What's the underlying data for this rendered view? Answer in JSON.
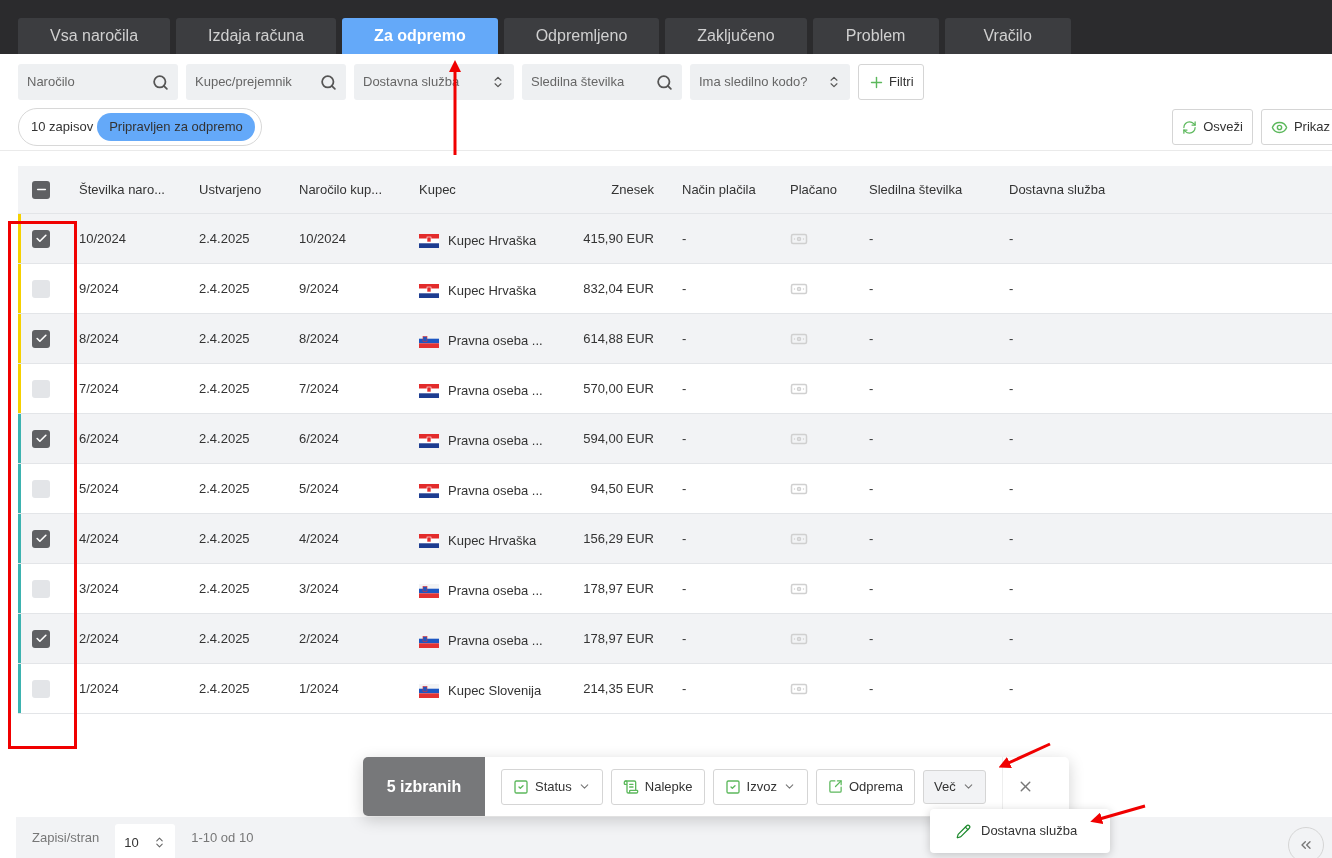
{
  "tabs": [
    {
      "label": "Vsa naročila",
      "selected": false
    },
    {
      "label": "Izdaja računa",
      "selected": false
    },
    {
      "label": "Za odpremo",
      "selected": true
    },
    {
      "label": "Odpremljeno",
      "selected": false
    },
    {
      "label": "Zaključeno",
      "selected": false
    },
    {
      "label": "Problem",
      "selected": false
    },
    {
      "label": "Vračilo",
      "selected": false
    }
  ],
  "filters": [
    {
      "kind": "search",
      "placeholder": "Naročilo"
    },
    {
      "kind": "search",
      "placeholder": "Kupec/prejemnik"
    },
    {
      "kind": "select",
      "placeholder": "Dostavna služba"
    },
    {
      "kind": "search",
      "placeholder": "Sledilna številka"
    },
    {
      "kind": "select",
      "placeholder": "Ima sledilno kodo?"
    }
  ],
  "filters_button": "Filtri",
  "summary": {
    "count": "10 zapisov",
    "badge": "Pripravljen za odpremo"
  },
  "toolbar_buttons": [
    {
      "kind": "refresh",
      "label": "Osveži"
    },
    {
      "kind": "view",
      "label": "Prikaz"
    }
  ],
  "table": {
    "select_all_indeterminate": true,
    "columns": [
      "Številka naro...",
      "Ustvarjeno",
      "Naročilo kup...",
      "Kupec",
      "Znesek",
      "Način plačila",
      "Plačano",
      "Sledilna številka",
      "Dostavna služba"
    ],
    "rows": [
      {
        "checked": true,
        "color": "#f5d000",
        "order": "10/2024",
        "created": "2.4.2025",
        "customer_order": "10/2024",
        "kind": "hr",
        "customer": "Kupec Hrvaška",
        "amount": "415,90 EUR",
        "payment": "-",
        "tracking": "-",
        "delivery": "-"
      },
      {
        "checked": false,
        "color": "#f5d000",
        "order": "9/2024",
        "created": "2.4.2025",
        "customer_order": "9/2024",
        "kind": "hr",
        "customer": "Kupec Hrvaška",
        "amount": "832,04 EUR",
        "payment": "-",
        "tracking": "-",
        "delivery": "-"
      },
      {
        "checked": true,
        "color": "#f5d000",
        "order": "8/2024",
        "created": "2.4.2025",
        "customer_order": "8/2024",
        "kind": "si",
        "customer": "Pravna oseba ...",
        "amount": "614,88 EUR",
        "payment": "-",
        "tracking": "-",
        "delivery": "-"
      },
      {
        "checked": false,
        "color": "#f5d000",
        "order": "7/2024",
        "created": "2.4.2025",
        "customer_order": "7/2024",
        "kind": "hr",
        "customer": "Pravna oseba ...",
        "amount": "570,00 EUR",
        "payment": "-",
        "tracking": "-",
        "delivery": "-"
      },
      {
        "checked": true,
        "color": "#3bb3b0",
        "order": "6/2024",
        "created": "2.4.2025",
        "customer_order": "6/2024",
        "kind": "hr",
        "customer": "Pravna oseba ...",
        "amount": "594,00 EUR",
        "payment": "-",
        "tracking": "-",
        "delivery": "-"
      },
      {
        "checked": false,
        "color": "#3bb3b0",
        "order": "5/2024",
        "created": "2.4.2025",
        "customer_order": "5/2024",
        "kind": "hr",
        "customer": "Pravna oseba ...",
        "amount": "94,50 EUR",
        "payment": "-",
        "tracking": "-",
        "delivery": "-"
      },
      {
        "checked": true,
        "color": "#3bb3b0",
        "order": "4/2024",
        "created": "2.4.2025",
        "customer_order": "4/2024",
        "kind": "hr",
        "customer": "Kupec Hrvaška",
        "amount": "156,29 EUR",
        "payment": "-",
        "tracking": "-",
        "delivery": "-"
      },
      {
        "checked": false,
        "color": "#3bb3b0",
        "order": "3/2024",
        "created": "2.4.2025",
        "customer_order": "3/2024",
        "kind": "si",
        "customer": "Pravna oseba ...",
        "amount": "178,97 EUR",
        "payment": "-",
        "tracking": "-",
        "delivery": "-"
      },
      {
        "checked": true,
        "color": "#3bb3b0",
        "order": "2/2024",
        "created": "2.4.2025",
        "customer_order": "2/2024",
        "kind": "si",
        "customer": "Pravna oseba ...",
        "amount": "178,97 EUR",
        "payment": "-",
        "tracking": "-",
        "delivery": "-"
      },
      {
        "checked": false,
        "color": "#3bb3b0",
        "order": "1/2024",
        "created": "2.4.2025",
        "customer_order": "1/2024",
        "kind": "si",
        "customer": "Kupec Slovenija",
        "amount": "214,35 EUR",
        "payment": "-",
        "tracking": "-",
        "delivery": "-"
      }
    ]
  },
  "selection_bar": {
    "count": "5 izbranih",
    "actions": [
      {
        "kind": "check",
        "label": "Status",
        "dropdown": true
      },
      {
        "kind": "label",
        "label": "Nalepke",
        "dropdown": false
      },
      {
        "kind": "check",
        "label": "Izvoz",
        "dropdown": true
      },
      {
        "kind": "external",
        "label": "Odprema",
        "dropdown": false
      }
    ],
    "more": "Več",
    "menu": [
      {
        "kind": "edit",
        "label": "Dostavna služba"
      }
    ]
  },
  "footer": {
    "label": "Zapisi/stran",
    "page_size": "10",
    "range": "1-10 od 10"
  }
}
